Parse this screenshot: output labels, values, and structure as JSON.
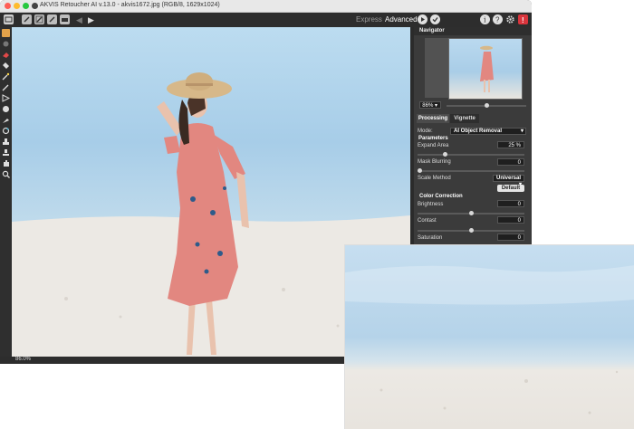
{
  "window": {
    "title": "AKVIS Retoucher AI v.13.0 - akvis1672.jpg (RGB/8, 1629x1024)",
    "traffic_lights": [
      "#fe5f57",
      "#febc2e",
      "#28c840"
    ]
  },
  "toolbar": {
    "mode_express": "Express",
    "mode_advanced": "Advanced",
    "icons": [
      "open-icon",
      "edit-icon",
      "edit-alt-icon",
      "batch-icon",
      "undo-icon",
      "redo-icon",
      "run-icon",
      "apply-icon",
      "info-icon",
      "help-icon",
      "settings-icon",
      "notifications-icon"
    ]
  },
  "tools": [
    "hand-tool-icon",
    "brush-icon",
    "eraser-icon",
    "bucket-icon",
    "magic-wand-icon",
    "pipette-icon",
    "lasso-icon",
    "selection-icon",
    "brush-alt-icon",
    "clone-icon",
    "stamp-icon",
    "patch-icon",
    "hand-icon",
    "zoom-icon"
  ],
  "status": {
    "zoom": "86.0%"
  },
  "navigator": {
    "title": "Navigator",
    "zoom_value": "86%"
  },
  "tabs": {
    "processing": "Processing",
    "vignette": "Vignette"
  },
  "settings": {
    "mode_label": "Mode:",
    "mode_value": "AI Object Removal",
    "parameters_title": "Parameters",
    "expand_area_label": "Expand Area",
    "expand_area_value": "25 %",
    "expand_area_level": 0.25,
    "mask_blurring_label": "Mask Blurring",
    "mask_blurring_value": "0",
    "mask_blurring_level": 0,
    "scale_method_label": "Scale Method",
    "scale_method_value": "Universal",
    "default_button": "Default",
    "color_correction_title": "Color Correction",
    "brightness_label": "Brightness",
    "brightness_value": "0",
    "contrast_label": "Contast",
    "contrast_value": "0",
    "saturation_label": "Saturation",
    "saturation_value": "0"
  },
  "colors": {
    "window_bg": "#3a3a3a",
    "panel_bg": "#3b3b3b",
    "sky": "#a7cde8",
    "sand": "#ebe8e3",
    "dress": "#e28780",
    "hat": "#d7b889",
    "close_button": "#d9343c"
  }
}
